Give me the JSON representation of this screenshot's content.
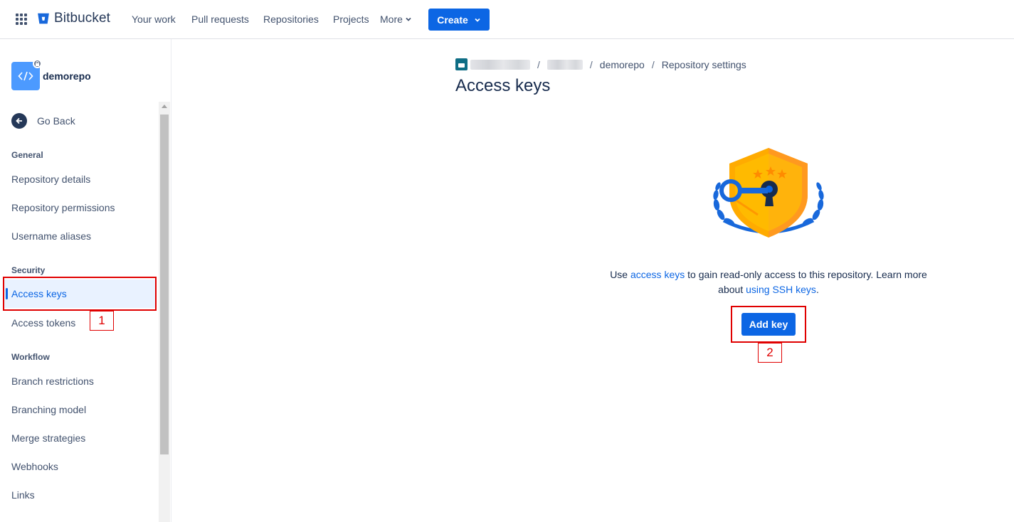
{
  "topbar": {
    "brand": "Bitbucket",
    "nav": [
      "Your work",
      "Pull requests",
      "Repositories",
      "Projects"
    ],
    "more": "More",
    "create": "Create"
  },
  "sidebar": {
    "repo_name": "demorepo",
    "go_back": "Go Back",
    "sections": {
      "general": "General",
      "security": "Security",
      "workflow": "Workflow"
    },
    "general_items": [
      "Repository details",
      "Repository permissions",
      "Username aliases"
    ],
    "security_items": [
      "Access keys",
      "Access tokens"
    ],
    "workflow_items": [
      "Branch restrictions",
      "Branching model",
      "Merge strategies",
      "Webhooks",
      "Links"
    ]
  },
  "breadcrumb": {
    "repo": "demorepo",
    "current": "Repository settings",
    "separator": "/"
  },
  "main": {
    "title": "Access keys",
    "desc_prefix": "Use ",
    "desc_link1": "access keys",
    "desc_middle": " to gain read-only access to this repository. Learn more about ",
    "desc_link2": "using SSH keys",
    "desc_suffix": ".",
    "add_key": "Add key"
  },
  "annotations": {
    "label1": "1",
    "label2": "2"
  },
  "colors": {
    "primary": "#0c66e4",
    "annotation": "#e00000"
  }
}
